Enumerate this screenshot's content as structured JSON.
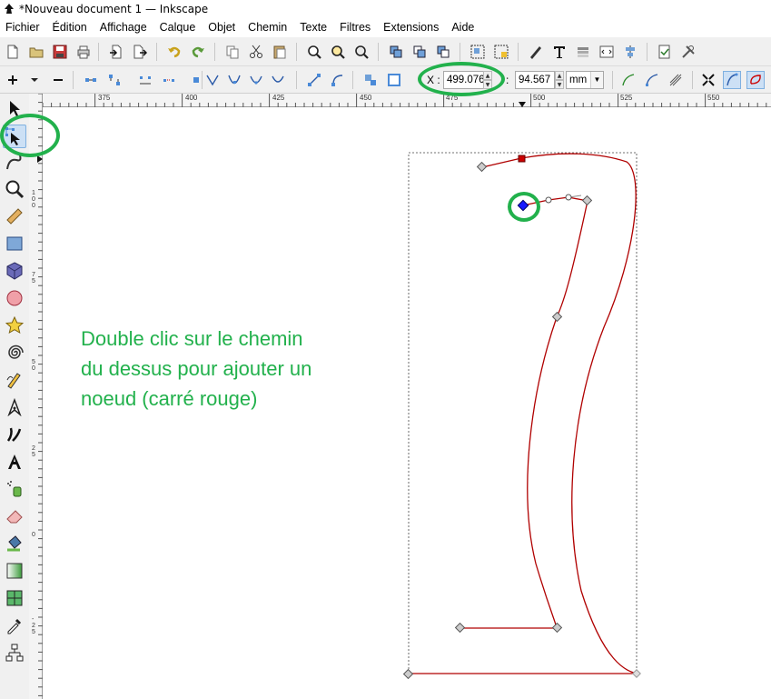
{
  "window": {
    "title": "*Nouveau document 1 — Inkscape"
  },
  "menubar": {
    "items": [
      "Fichier",
      "Édition",
      "Affichage",
      "Calque",
      "Objet",
      "Chemin",
      "Texte",
      "Filtres",
      "Extensions",
      "Aide"
    ]
  },
  "controls": {
    "x_label": "X :",
    "x_value": "499.076",
    "y_separator": ":",
    "y_value": "94.567",
    "unit": "mm"
  },
  "ruler": {
    "h_labels": [
      "375",
      "400",
      "425",
      "450",
      "475",
      "500",
      "525",
      "550"
    ],
    "v_labels": [
      "1 0 0",
      "7 5",
      "5 0",
      "2 5",
      "0",
      "- 2 5"
    ]
  },
  "canvas": {
    "annotation": "Double clic sur le chemin\ndu dessus  pour ajouter un\nnoeud (carré rouge)"
  },
  "colors": {
    "annotation": "#22b14c",
    "path_stroke": "#b00000",
    "selected_node": "#0000cc",
    "new_node": "#cc0000"
  }
}
